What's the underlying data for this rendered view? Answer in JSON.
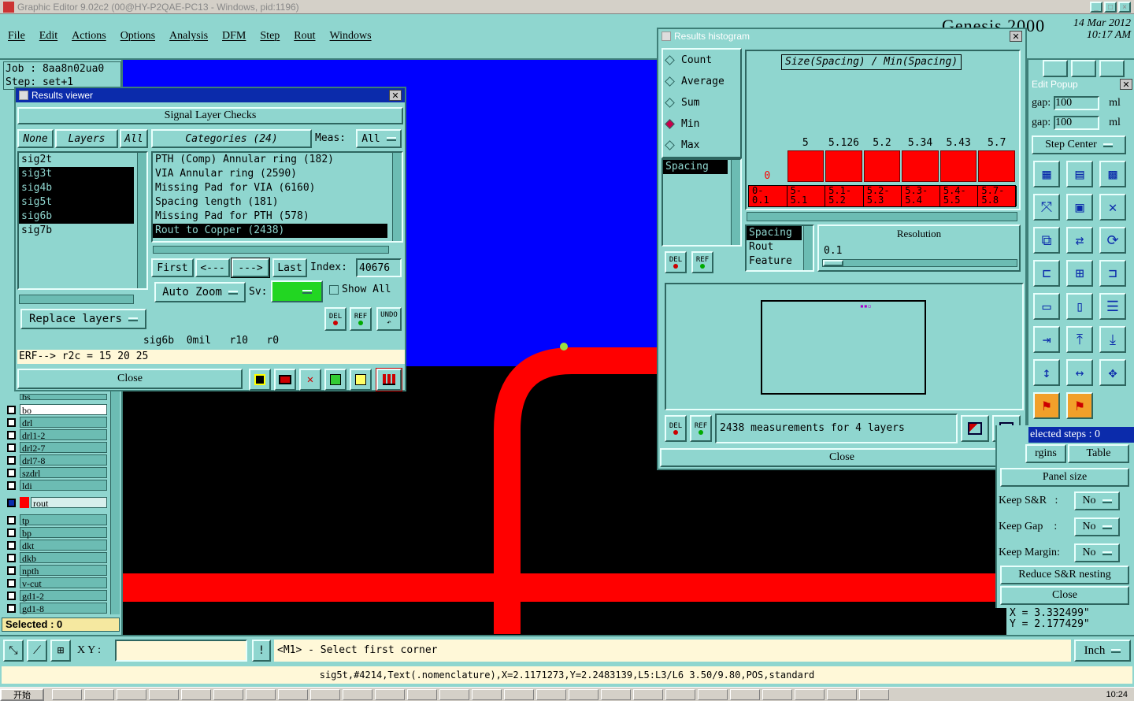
{
  "app": {
    "title": "Graphic Editor 9.02c2 (00@HY-P2QAE-PC13 - Windows, pid:1196)",
    "brand": "Genesis 2000",
    "date": "14 Mar 2012",
    "time": "10:17 AM"
  },
  "menu": [
    "File",
    "Edit",
    "Actions",
    "Options",
    "Analysis",
    "DFM",
    "Step",
    "Rout",
    "Windows"
  ],
  "job": {
    "label": "Job : 8aa8n02ua0",
    "step": "Step: set+1"
  },
  "layers_panel": {
    "rows": [
      {
        "name": "bo",
        "color": "#ffffff"
      },
      {
        "name": "drl"
      },
      {
        "name": "drl1-2"
      },
      {
        "name": "drl2-7"
      },
      {
        "name": "drl7-8"
      },
      {
        "name": "szdrl"
      },
      {
        "name": "ldi"
      },
      {
        "name": "rout",
        "active": true
      },
      {
        "name": "tp"
      },
      {
        "name": "bp"
      },
      {
        "name": "dkt"
      },
      {
        "name": "dkb"
      },
      {
        "name": "npth"
      },
      {
        "name": "v-cut"
      },
      {
        "name": "gd1-2"
      },
      {
        "name": "gd1-8"
      }
    ],
    "partial_top": "bs",
    "selected": "Selected : 0"
  },
  "results_viewer": {
    "title": "Results viewer",
    "header": "Signal Layer Checks",
    "none_btn": "None",
    "layers_btn": "Layers",
    "all_btn": "All",
    "layers": [
      {
        "name": "sig2t",
        "selected": false
      },
      {
        "name": "sig3t",
        "selected": true
      },
      {
        "name": "sig4b",
        "selected": true
      },
      {
        "name": "sig5t",
        "selected": true
      },
      {
        "name": "sig6b",
        "selected": true
      },
      {
        "name": "sig7b",
        "selected": false
      }
    ],
    "categories_btn": "Categories (24)",
    "meas_label": "Meas:",
    "meas_value": "All",
    "categories": [
      {
        "text": "PTH (Comp) Annular ring (182)",
        "selected": false
      },
      {
        "text": "VIA Annular ring (2590)",
        "selected": false
      },
      {
        "text": "Missing Pad for VIA (6160)",
        "selected": false
      },
      {
        "text": "Spacing length (181)",
        "selected": false
      },
      {
        "text": "Missing Pad for PTH (578)",
        "selected": false
      },
      {
        "text": "Rout to Copper (2438)",
        "selected": true
      }
    ],
    "first": "First",
    "prev": "<---",
    "next": "--->",
    "last": "Last",
    "index_label": "Index:",
    "index_value": "40676",
    "auto_zoom": "Auto Zoom",
    "sv_label": "Sv:",
    "show_all": "Show All",
    "replace_layers": "Replace layers",
    "del": "DEL",
    "ref": "REF",
    "undo": "UNDO",
    "status1": "sig6b  0mil   r10   r0",
    "status2": "ERF--> r2c = 15 20 25",
    "close": "Close"
  },
  "histogram": {
    "title": "Results histogram",
    "modes": [
      {
        "label": "Count",
        "checked": false
      },
      {
        "label": "Average",
        "checked": false
      },
      {
        "label": "Sum",
        "checked": false
      },
      {
        "label": "Min",
        "checked": true
      },
      {
        "label": "Max",
        "checked": false
      }
    ],
    "measure_list": [
      "Spacing"
    ],
    "del": "DEL",
    "ref": "REF",
    "axis_list": [
      {
        "text": "Spacing",
        "selected": true
      },
      {
        "text": "Rout",
        "selected": false
      },
      {
        "text": "Feature",
        "selected": false
      }
    ],
    "resolution_label": "Resolution",
    "resolution_value": "0.1",
    "summary": "2438 measurements for 4 layers",
    "close": "Close"
  },
  "chart_data": {
    "type": "bar",
    "title": "Size(Spacing) / Min(Spacing)",
    "categories": [
      "0-\n0.1",
      "5-\n5.1",
      "5.1-\n5.2",
      "5.2-\n5.3",
      "5.3-\n5.4",
      "5.4-\n5.5",
      "5.7-\n5.8"
    ],
    "values": [
      0,
      5,
      5.126,
      5.2,
      5.34,
      5.43,
      5.7
    ],
    "labels": [
      "0",
      "5",
      "5.126",
      "5.2",
      "5.34",
      "5.43",
      "5.7"
    ],
    "ylim": [
      0,
      5.7
    ],
    "bar_color": "#ff0000",
    "zero_label_color": "#ff0000"
  },
  "edit_popup": {
    "title": "Edit Popup",
    "gap1_label": "gap:",
    "gap1_value": "100",
    "gap1_unit": "ml",
    "gap2_label": "gap:",
    "gap2_value": "100",
    "gap2_unit": "ml",
    "step_center": "Step Center",
    "selected_steps": "elected steps : 0",
    "margins": "rgins",
    "table": "Table",
    "panel_size": "Panel size",
    "keep_sr": "Keep S&R   :",
    "keep_gap": "Keep Gap    :",
    "keep_margin": "Keep Margin:",
    "no": "No",
    "reduce": "Reduce S&R nesting",
    "close": "Close"
  },
  "coords": {
    "x": "X = 3.332499\"",
    "y": "Y = 2.177429\""
  },
  "bottom": {
    "xy_label": "X Y :",
    "prompt": "<M1> - Select first corner",
    "units": "Inch",
    "status": "sig5t,#4214,Text(.nomenclature),X=2.1171273,Y=2.2483139,L5:L3/L6 3.50/9.80,POS,standard"
  },
  "colors": {
    "canvas_blue": "#0000ff",
    "rout_red": "#ff0000",
    "magenta": "#ff00ff",
    "ui_teal": "#8fd6cf",
    "title_blue": "#0b2bab"
  },
  "taskbar": {
    "start": "开始",
    "time": "10:24"
  }
}
